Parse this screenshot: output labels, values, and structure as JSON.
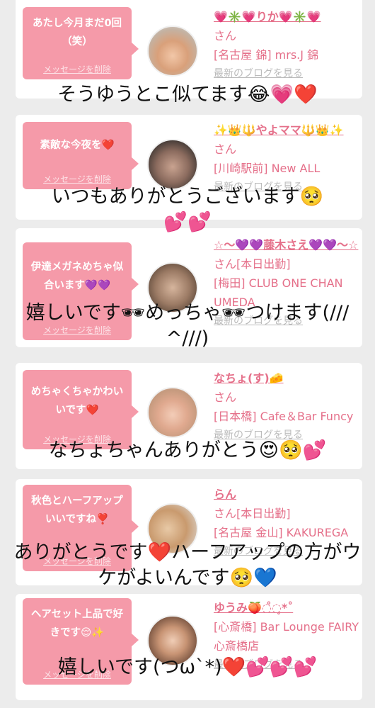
{
  "cards": [
    {
      "message": "あたし今月まだ0回（笑）",
      "delete_label": "メッセージを削除",
      "name": "💗✳️💗りか💗✳️💗",
      "san": "さん",
      "location": "[名古屋 錦] mrs.J 錦",
      "blog_link": "最新のブログを見る",
      "overlay": "そうゆうとこ似てます😂💗❤️"
    },
    {
      "message": "素敵な今夜を❤️",
      "delete_label": "メッセージを削除",
      "name": "✨👑🔱やよママ🔱👑✨",
      "san": "さん",
      "location": "[川崎駅前] New ALL",
      "blog_link": "最新のブログを見る",
      "overlay": "いつもありがとうございます🥺\n💕💕"
    },
    {
      "message": "伊達メガネめちゃ似合います💜💜",
      "delete_label": "メッセージを削除",
      "name": "☆〜💜💜藤木さえ💜💜〜☆",
      "san": "さん[本日出勤]",
      "location": "[梅田] CLUB ONE CHAN UMEDA",
      "blog_link": "最新のブログを見る",
      "overlay": "嬉しいです🕶めっちゃ🕶つけます(/// ^///)"
    },
    {
      "message": "めちゃくちゃかわいいです❤️",
      "delete_label": "メッセージを削除",
      "name": "なちょ(す)🧀",
      "san": "さん",
      "location": "[日本橋] Cafe＆Bar Funcy",
      "blog_link": "最新のブログを見る",
      "overlay": "なちょちゃんありがとう😍🥺💕"
    },
    {
      "message": "秋色とハーフアップいいですね❣️",
      "delete_label": "メッセージを削除",
      "name": "らん",
      "san": "さん[本日出勤]",
      "location": "[名古屋 金山] KAKUREGA",
      "blog_link": "最新のブログを見る",
      "overlay": "ありがとうです❤️ハーフアップの方がウケがよいんです🥺💙"
    },
    {
      "message": "ヘアセット上品で好きです😌✨",
      "delete_label": "メッセージを削除",
      "name": "ゆうみ🍑◌̊◌̥*˚",
      "san": "さん",
      "location": "[心斎橋] Bar Lounge FAIRY 心斎橋店",
      "blog_link": "最新のブログを見る",
      "overlay": "嬉しいです(つω`*)❤️💕💕💕"
    }
  ],
  "colors": {
    "bubble": "#f59aa9",
    "accent": "#e5708a",
    "background": "#ececec"
  }
}
